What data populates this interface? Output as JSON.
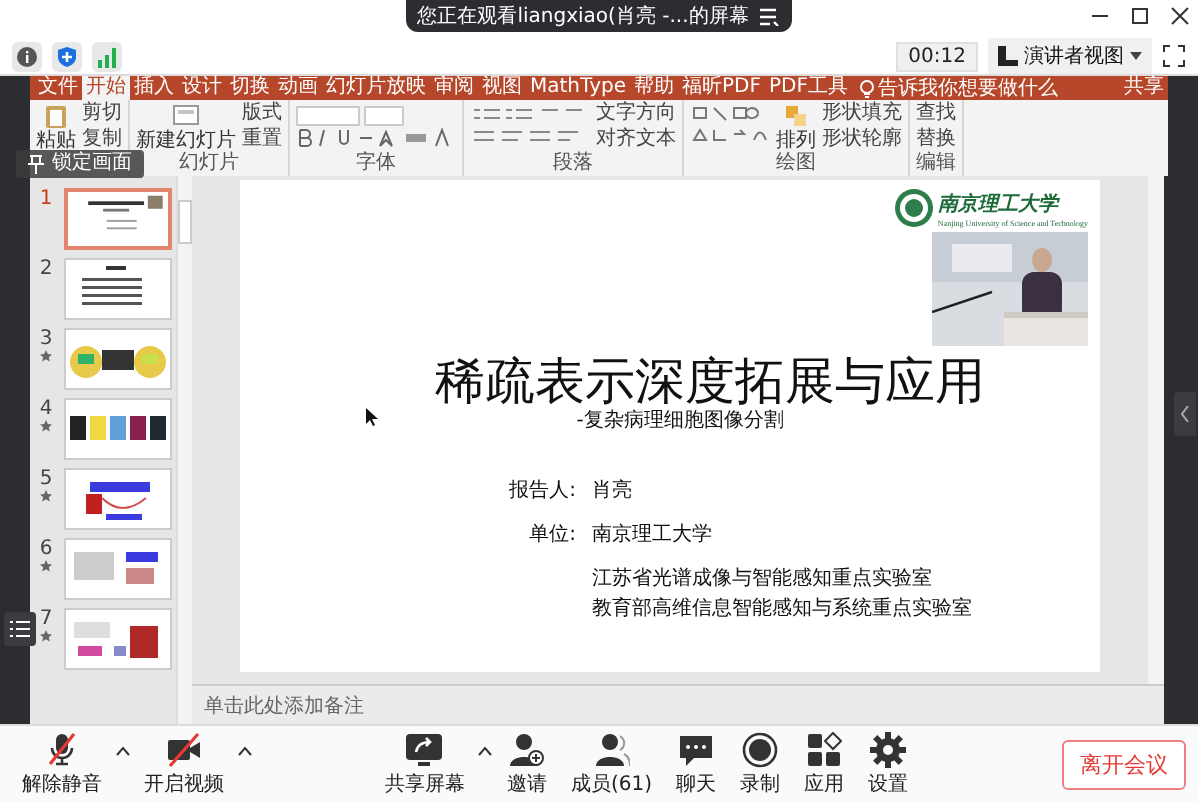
{
  "banner": {
    "text": "您正在观看liangxiao(肖亮 -...的屏幕"
  },
  "timer": "00:12",
  "view_button": {
    "label": "演讲者视图"
  },
  "ribbon": {
    "tabs": [
      {
        "label": "文件",
        "selected": false
      },
      {
        "label": "开始",
        "selected": true
      },
      {
        "label": "插入",
        "selected": false
      },
      {
        "label": "设计",
        "selected": false
      },
      {
        "label": "切换",
        "selected": false
      },
      {
        "label": "动画",
        "selected": false
      },
      {
        "label": "幻灯片放映",
        "selected": false
      },
      {
        "label": "审阅",
        "selected": false
      },
      {
        "label": "视图",
        "selected": false
      },
      {
        "label": "MathType",
        "selected": false
      },
      {
        "label": "帮助",
        "selected": false
      },
      {
        "label": "福昕PDF",
        "selected": false
      },
      {
        "label": "PDF工具",
        "selected": false
      }
    ],
    "tell_me": "告诉我你想要做什么",
    "share": "共享",
    "groups": [
      {
        "kind": "clipboard",
        "big": "粘贴",
        "small": [
          "剪切",
          "复制"
        ]
      },
      {
        "label": "幻灯片",
        "kind": "slides",
        "big": "新建幻灯片",
        "small": [
          "版式",
          "重置"
        ]
      },
      {
        "label": "字体",
        "kind": "font"
      },
      {
        "label": "段落",
        "kind": "paragraph",
        "small": [
          "文字方向",
          "对齐文本"
        ]
      },
      {
        "label": "绘图",
        "kind": "drawing",
        "big": "排列",
        "small": [
          "形状填充",
          "形状轮廓"
        ]
      },
      {
        "label": "编辑",
        "kind": "editing",
        "small": [
          "查找",
          "替换"
        ]
      }
    ]
  },
  "lock_overlay": "锁定画面",
  "thumbnails": [
    {
      "number": "1",
      "selected": true,
      "animated": false
    },
    {
      "number": "2",
      "selected": false,
      "animated": false
    },
    {
      "number": "3",
      "selected": false,
      "animated": true
    },
    {
      "number": "4",
      "selected": false,
      "animated": true
    },
    {
      "number": "5",
      "selected": false,
      "animated": true
    },
    {
      "number": "6",
      "selected": false,
      "animated": true
    },
    {
      "number": "7",
      "selected": false,
      "animated": true
    }
  ],
  "slide": {
    "logo_text": "南京理工大学",
    "logo_subtext": "Nanjing University of Science and Technology",
    "title": "稀疏表示深度拓展与应用",
    "subtitle": "-复杂病理细胞图像分割",
    "reporter_label": "报告人:",
    "reporter": "肖亮",
    "unit_label": "单位:",
    "unit": "南京理工大学",
    "labs": [
      "江苏省光谱成像与智能感知重点实验室",
      "教育部高维信息智能感知与系统重点实验室"
    ]
  },
  "notes_placeholder": "单击此处添加备注",
  "toolbar": {
    "items": [
      {
        "kind": "mic",
        "label": "解除静音",
        "muted": true
      },
      {
        "kind": "video",
        "label": "开启视频",
        "muted": true
      },
      {
        "kind": "share",
        "label": "共享屏幕"
      },
      {
        "kind": "invite",
        "label": "邀请"
      },
      {
        "kind": "members",
        "label": "成员(61)"
      },
      {
        "kind": "chat",
        "label": "聊天"
      },
      {
        "kind": "record",
        "label": "录制"
      },
      {
        "kind": "apps",
        "label": "应用"
      },
      {
        "kind": "settings",
        "label": "设置"
      }
    ],
    "leave": "离开会议"
  }
}
